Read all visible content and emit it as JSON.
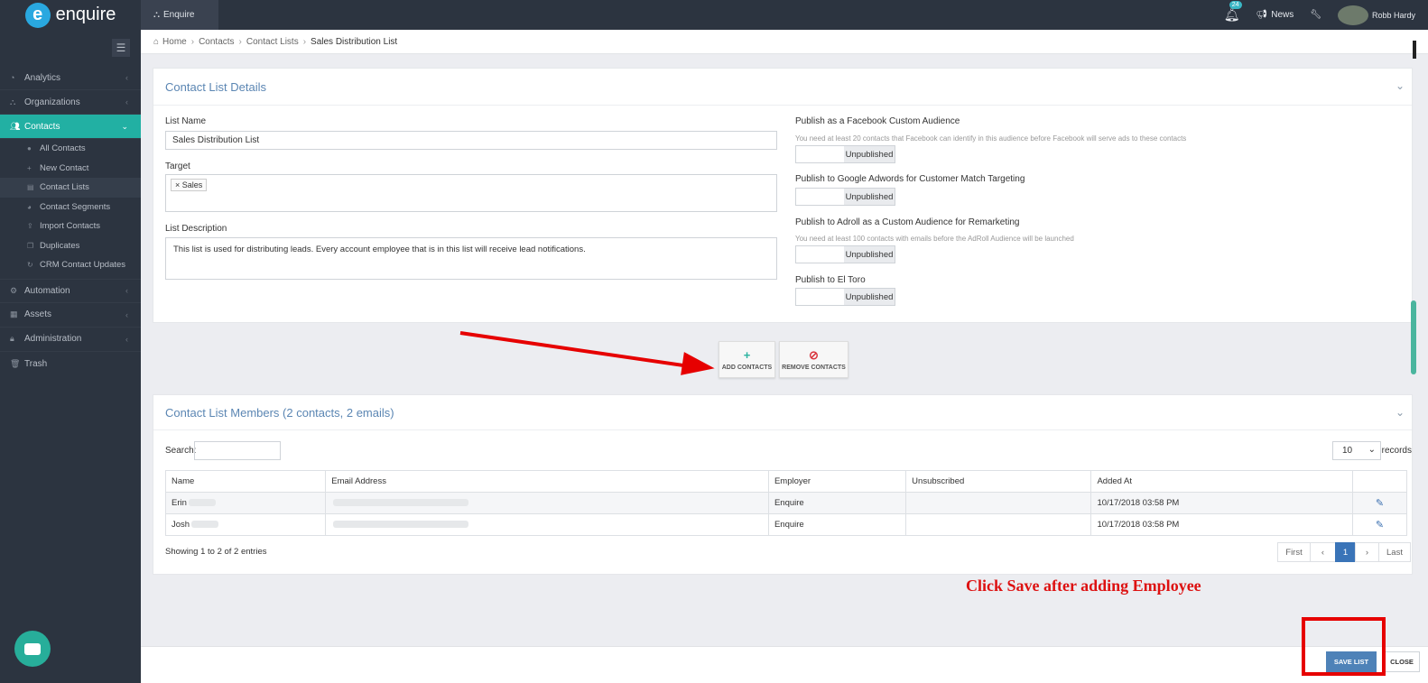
{
  "brand": {
    "name": "enquire",
    "mark": "e"
  },
  "topbar": {
    "tab_label": "Enquire",
    "notification_count": "24",
    "news_label": "News",
    "user_name": "Robb Hardy"
  },
  "sidebar": {
    "items": [
      {
        "label": "Analytics",
        "icon": "analytics-icon"
      },
      {
        "label": "Organizations",
        "icon": "org-icon"
      },
      {
        "label": "Contacts",
        "icon": "users-icon"
      },
      {
        "label": "Automation",
        "icon": "gears-icon"
      },
      {
        "label": "Assets",
        "icon": "grid-icon"
      },
      {
        "label": "Administration",
        "icon": "lock-icon"
      },
      {
        "label": "Trash",
        "icon": "trash-icon"
      }
    ],
    "contacts_sub": [
      {
        "label": "All Contacts"
      },
      {
        "label": "New Contact"
      },
      {
        "label": "Contact Lists"
      },
      {
        "label": "Contact Segments"
      },
      {
        "label": "Import Contacts"
      },
      {
        "label": "Duplicates"
      },
      {
        "label": "CRM Contact Updates"
      }
    ]
  },
  "breadcrumb": [
    "Home",
    "Contacts",
    "Contact Lists",
    "Sales Distribution List"
  ],
  "details": {
    "title": "Contact List Details",
    "list_name_label": "List Name",
    "list_name_value": "Sales Distribution List",
    "target_label": "Target",
    "target_tag": "Sales",
    "description_label": "List Description",
    "description_value": "This list is used for distributing leads. Every account employee that is in this list will receive lead notifications.",
    "facebook_label": "Publish as a Facebook Custom Audience",
    "facebook_hint": "You need at least 20 contacts that Facebook can identify in this audience before Facebook will serve ads to these contacts",
    "facebook_state": "Unpublished",
    "google_label": "Publish to Google Adwords for Customer Match Targeting",
    "google_state": "Unpublished",
    "adroll_label": "Publish to Adroll as a Custom Audience for Remarketing",
    "adroll_hint": "You need at least 100 contacts with emails before the AdRoll Audience will be launched",
    "adroll_state": "Unpublished",
    "eltoro_label": "Publish to El Toro",
    "eltoro_state": "Unpublished"
  },
  "actions": {
    "add_label": "ADD CONTACTS",
    "remove_label": "REMOVE CONTACTS"
  },
  "members": {
    "title": "Contact List Members (2 contacts, 2 emails)",
    "search_label": "Search:",
    "page_length": "10",
    "records_label": "records",
    "columns": [
      "Name",
      "Email Address",
      "Employer",
      "Unsubscribed",
      "Added At"
    ],
    "rows": [
      {
        "name": "Erin",
        "employer": "Enquire",
        "unsubscribed": "",
        "added_at": "10/17/2018 03:58 PM"
      },
      {
        "name": "Josh",
        "employer": "Enquire",
        "unsubscribed": "",
        "added_at": "10/17/2018 03:58 PM"
      }
    ],
    "showing": "Showing 1 to 2 of 2 entries",
    "pager": {
      "first": "First",
      "prev": "‹",
      "current": "1",
      "next": "›",
      "last": "Last"
    }
  },
  "annotation": "Click Save after adding Employee",
  "footer": {
    "save_label": "SAVE LIST",
    "close_label": "CLOSE"
  },
  "colors": {
    "accent": "#22b0a3",
    "primary": "#3a74b8",
    "annotation": "#e60000"
  }
}
